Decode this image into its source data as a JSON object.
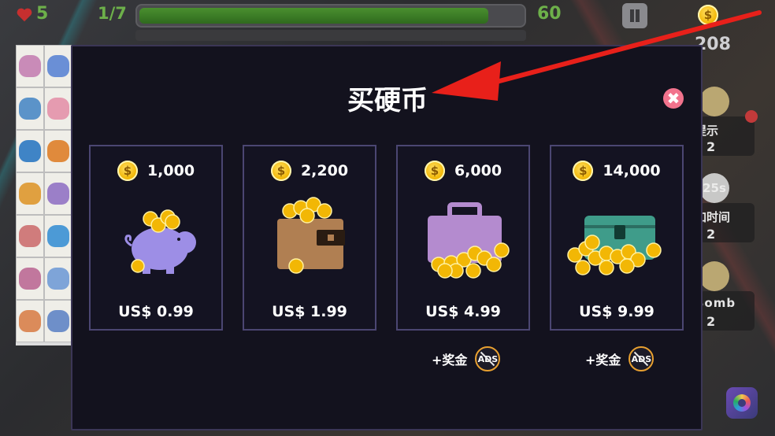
{
  "hud": {
    "lives": "5",
    "level": "1/7",
    "progress": 0.9,
    "timer": "60",
    "coin_total": "208",
    "coin_symbol": "$"
  },
  "sidebar": {
    "items": [
      {
        "label": "提示",
        "count": "2",
        "icon": "lightbulb-icon"
      },
      {
        "label": "加时间",
        "count": "2",
        "badge": "25s",
        "icon": "stopwatch-icon"
      },
      {
        "label": "Bomb",
        "count": "2",
        "icon": "bomb-icon"
      }
    ]
  },
  "modal": {
    "title": "买硬币",
    "close_glyph": "✖",
    "packs": [
      {
        "amount": "1,000",
        "price": "US$ 0.99",
        "icon": "piggy-bank-icon"
      },
      {
        "amount": "2,200",
        "price": "US$ 1.99",
        "icon": "wallet-icon"
      },
      {
        "amount": "6,000",
        "price": "US$ 4.99",
        "icon": "briefcase-icon",
        "bonus": "+奖金",
        "noads": "ADS"
      },
      {
        "amount": "14,000",
        "price": "US$ 9.99",
        "icon": "treasure-chest-icon",
        "bonus": "+奖金",
        "noads": "ADS"
      }
    ]
  },
  "colors": {
    "accent_green": "#6db04a",
    "modal_bg": "#13121e",
    "card_border": "#4b4672",
    "close_pink": "#f2738d",
    "annotation_red": "#e8201a"
  }
}
